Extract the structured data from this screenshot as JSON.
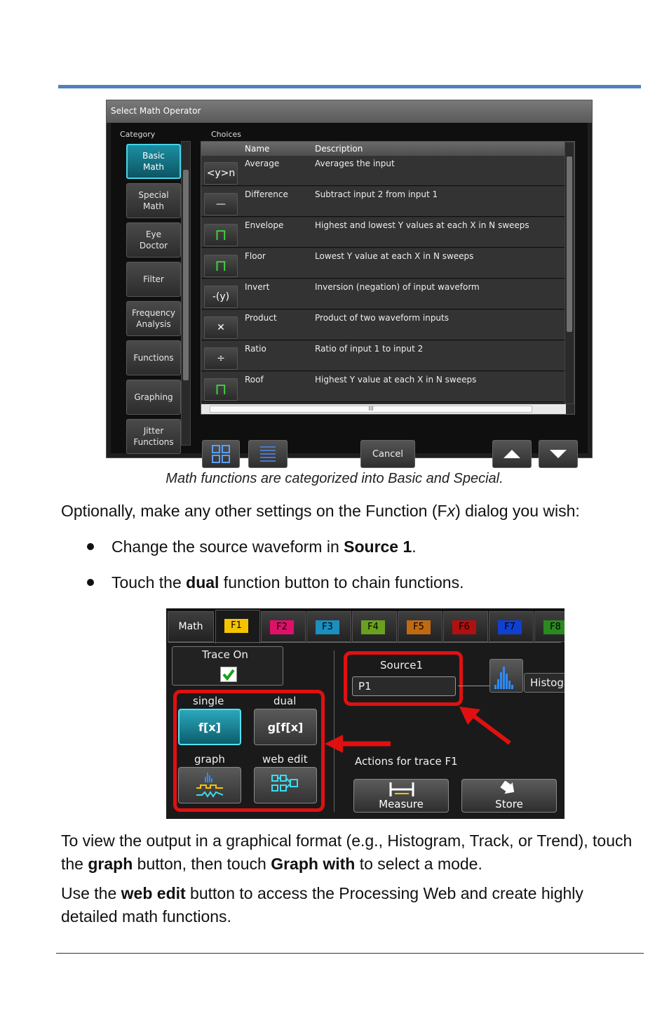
{
  "dialog1": {
    "title": "Select Math Operator",
    "category_label": "Category",
    "choices_label": "Choices",
    "categories": [
      {
        "label": "Basic\nMath",
        "active": true
      },
      {
        "label": "Special\nMath",
        "active": false
      },
      {
        "label": "Eye\nDoctor",
        "active": false
      },
      {
        "label": "Filter",
        "active": false
      },
      {
        "label": "Frequency\nAnalysis",
        "active": false
      },
      {
        "label": "Functions",
        "active": false
      },
      {
        "label": "Graphing",
        "active": false
      },
      {
        "label": "Jitter\nFunctions",
        "active": false
      }
    ],
    "columns": {
      "name": "Name",
      "description": "Description"
    },
    "rows": [
      {
        "icon": "average-icon",
        "glyph": "<y>n",
        "name": "Average",
        "description": "Averages the input"
      },
      {
        "icon": "minus-icon",
        "glyph": "—",
        "name": "Difference",
        "description": "Subtract input 2 from input 1"
      },
      {
        "icon": "envelope-wave-icon",
        "glyph": "⊓",
        "name": "Envelope",
        "description": "Highest and lowest Y values at each X in N sweeps"
      },
      {
        "icon": "floor-wave-icon",
        "glyph": "⊓",
        "name": "Floor",
        "description": "Lowest Y value at each X in N sweeps"
      },
      {
        "icon": "invert-icon",
        "glyph": "-(y)",
        "name": "Invert",
        "description": "Inversion (negation) of input waveform"
      },
      {
        "icon": "multiply-icon",
        "glyph": "✕",
        "name": "Product",
        "description": "Product of two waveform inputs"
      },
      {
        "icon": "divide-icon",
        "glyph": "÷",
        "name": "Ratio",
        "description": "Ratio of input 1 to input 2"
      },
      {
        "icon": "roof-wave-icon",
        "glyph": "⊓",
        "name": "Roof",
        "description": "Highest Y value at each X in N sweeps"
      }
    ],
    "cancel_label": "Cancel",
    "hscroll_grip": "III"
  },
  "caption": "Math functions are categorized into Basic and Special.",
  "paragraph1": {
    "before": "Optionally, make any other settings on the Function (F",
    "italic": "x",
    "after": ") dialog you wish:"
  },
  "bullets": [
    {
      "before": "Change the source waveform in ",
      "bold": "Source 1",
      "after": "."
    },
    {
      "before": "Touch the ",
      "bold": "dual",
      "after": " function button to chain functions."
    }
  ],
  "dialog2": {
    "tabs": [
      {
        "label": "Math",
        "color": ""
      },
      {
        "label": "F1",
        "color": "#f5c400"
      },
      {
        "label": "F2",
        "color": "#e0106a"
      },
      {
        "label": "F3",
        "color": "#1a8fc0"
      },
      {
        "label": "F4",
        "color": "#6aa020"
      },
      {
        "label": "F5",
        "color": "#c06a10"
      },
      {
        "label": "F6",
        "color": "#b01010"
      },
      {
        "label": "F7",
        "color": "#1040d0"
      },
      {
        "label": "F8",
        "color": "#2a8a20"
      }
    ],
    "trace_on": "Trace On",
    "source_label": "Source1",
    "source_value": "P1",
    "histogram_label": "Histog",
    "single_label": "single",
    "dual_label": "dual",
    "single_button": "f[x]",
    "dual_button": "g[f[x]",
    "graph_label": "graph",
    "web_edit_label": "web edit",
    "actions_label": "Actions for trace F1",
    "measure_label": "Measure",
    "store_label": "Store",
    "highlight_color": "#e01010"
  },
  "paragraph2": {
    "t1": "To view the output in a graphical format (e.g., Histogram, Track, or Trend), touch the ",
    "b1": "graph",
    "t2": " button, then touch ",
    "b2": "Graph with",
    "t3": " to select a mode."
  },
  "paragraph3": {
    "t1": "Use the ",
    "b1": "web edit",
    "t2": " button to access the Processing Web and create highly detailed math functions."
  }
}
